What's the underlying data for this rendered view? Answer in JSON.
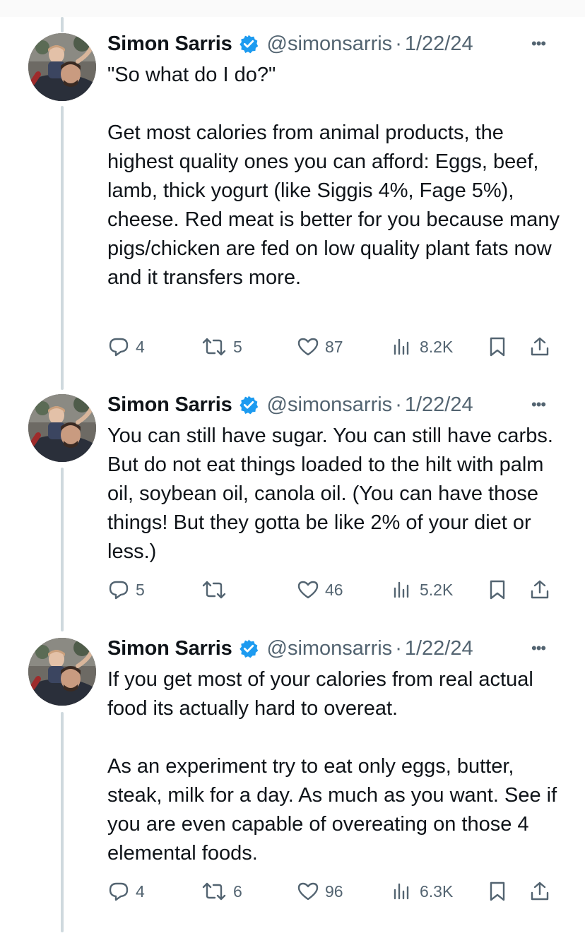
{
  "colors": {
    "verified": "#1d9bf0",
    "muted": "#536471",
    "thread_line": "#cfd9de"
  },
  "tweets": [
    {
      "name": "Simon Sarris",
      "handle": "@simonsarris",
      "date": "1/22/24",
      "dot": "·",
      "text": "\"So what do I do?\"\n\nGet most calories from animal products, the highest quality ones you can afford: Eggs, beef, lamb, thick yogurt (like Siggis 4%, Fage 5%), cheese. Red meat is better for you because many pigs/chicken are fed on low quality plant fats now and it transfers more.",
      "replies": "4",
      "reposts": "5",
      "likes": "87",
      "views": "8.2K"
    },
    {
      "name": "Simon Sarris",
      "handle": "@simonsarris",
      "date": "1/22/24",
      "dot": "·",
      "text": "You can still have sugar. You can still have carbs. But do not eat things loaded to the hilt with palm oil, soybean oil, canola oil. (You can have those things! But they gotta be like 2% of your diet or less.)",
      "replies": "5",
      "reposts": "",
      "likes": "46",
      "views": "5.2K"
    },
    {
      "name": "Simon Sarris",
      "handle": "@simonsarris",
      "date": "1/22/24",
      "dot": "·",
      "text": "If you get most of your calories from real actual food its actually hard to overeat.\n\nAs an experiment try to eat only eggs, butter, steak, milk for a day. As much as you want. See if you are even capable of overeating on those 4 elemental foods.",
      "replies": "4",
      "reposts": "6",
      "likes": "96",
      "views": "6.3K"
    }
  ]
}
